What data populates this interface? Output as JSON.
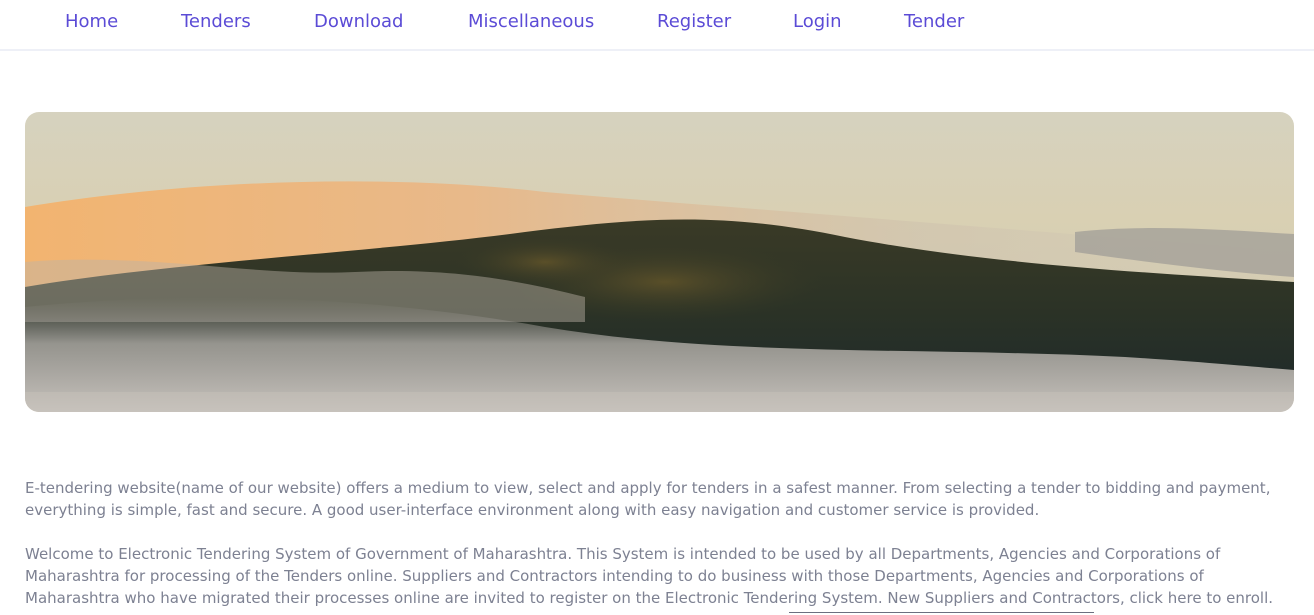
{
  "nav": {
    "items": [
      {
        "label": "Home"
      },
      {
        "label": "Tenders"
      },
      {
        "label": "Download"
      },
      {
        "label": "Miscellaneous"
      },
      {
        "label": "Register"
      },
      {
        "label": "Login"
      },
      {
        "label": "Tender"
      }
    ]
  },
  "hero": {
    "image": "misty-forested-hill-at-sunrise"
  },
  "content": {
    "intro": "E-tendering website(name of our website) offers a medium to view, select and apply for tenders in a safest manner. From selecting a tender to bidding and payment, everything is simple, fast and secure. A good user-interface environment along with easy navigation and customer service is provided.",
    "welcome": "Welcome to Electronic Tendering System of Government of Maharashtra. This System is intended to be used by all Departments, Agencies and Corporations of Maharashtra for processing of the Tenders online. Suppliers and Contractors intending to do business with those Departments, Agencies and Corporations of Maharashtra who have migrated their processes online are invited to register on the Electronic Tendering System. New Suppliers and Contractors, click here to enroll."
  },
  "colors": {
    "nav_link": "#5b4bd6",
    "body_text": "#7d8192"
  }
}
